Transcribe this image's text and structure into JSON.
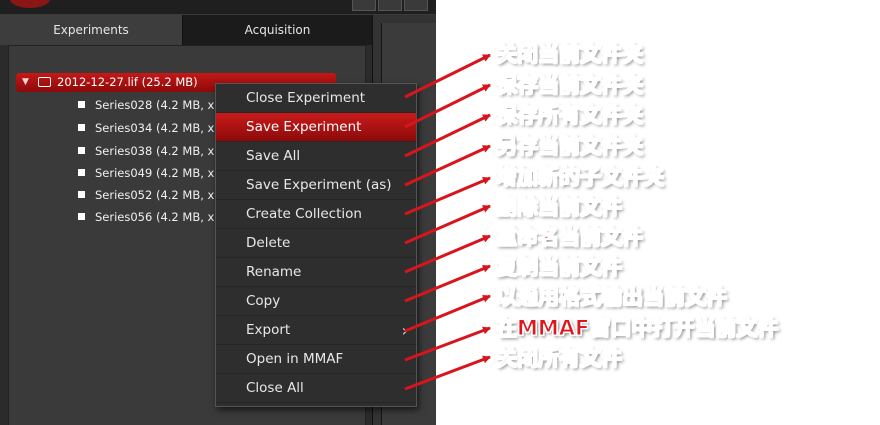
{
  "tabs": {
    "experiments": "Experiments",
    "acquisition": "Acquisition"
  },
  "experiment": {
    "name": "2012-12-27.lif (25.2 MB)"
  },
  "series": [
    "Series028 (4.2 MB, x",
    "Series034 (4.2 MB, x",
    "Series038 (4.2 MB, x",
    "Series049 (4.2 MB, x",
    "Series052 (4.2 MB, x",
    "Series056 (4.2 MB, x"
  ],
  "menu": {
    "items": [
      {
        "label": "Close Experiment"
      },
      {
        "label": "Save Experiment",
        "highlighted": true
      },
      {
        "label": "Save All"
      },
      {
        "label": "Save Experiment (as)"
      },
      {
        "label": "Create Collection"
      },
      {
        "label": "Delete"
      },
      {
        "label": "Rename"
      },
      {
        "label": "Copy"
      },
      {
        "label": "Export",
        "submenu": true,
        "chevron": "›"
      },
      {
        "label": "Open in MMAF"
      },
      {
        "label": "Close All"
      }
    ]
  },
  "annotations": [
    "关闭当前文件夹",
    "保存当前文件夹",
    "保存所有文件夹",
    "另存当前文件夹",
    "增加新的子文件夹",
    "删除当前文件",
    "重命名当前文件",
    "复制当前文件",
    "以通用格式输出当前文件",
    "在MMAF窗口中打开当前文件",
    "关闭所有文件"
  ],
  "colors": {
    "accent_red": "#c41818",
    "annotation_red": "#e0161f",
    "arrow_red": "#d8141c"
  },
  "icons": {
    "expand": "triangle-down-icon",
    "folder": "folder-open-icon",
    "checkbox": "checkbox-icon",
    "submenu": "chevron-right-icon"
  }
}
